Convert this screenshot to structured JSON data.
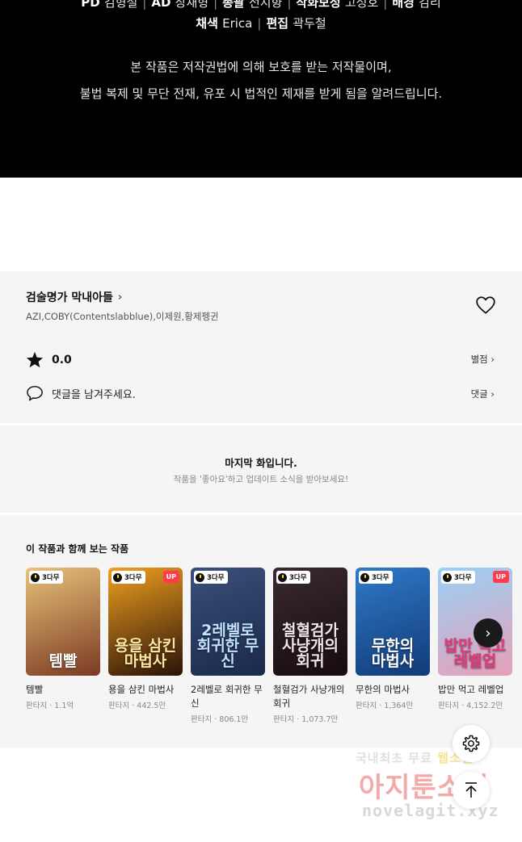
{
  "credits": {
    "line1": [
      {
        "role": "PD",
        "name": "김형철"
      },
      {
        "role": "AD",
        "name": "장재형"
      },
      {
        "role": "총괄",
        "name": "전지향"
      },
      {
        "role": "작화보정",
        "name": "고성호"
      },
      {
        "role": "배경",
        "name": "김리"
      }
    ],
    "line2": [
      {
        "role": "채색",
        "name": "Erica"
      },
      {
        "role": "편집",
        "name": "곽두철"
      }
    ],
    "separator": "|"
  },
  "notice": {
    "line1": "본 작품은 저작권법에 의해 보호를 받는 저작물이며,",
    "line2": "불법 복제 및 무단 전재, 유포 시 법적인 제재를 받게 됨을 알려드립니다."
  },
  "work": {
    "title": "검술명가 막내아들",
    "title_chevron": "›",
    "authors": "AZI,COBY(Contentslabblue),이제원,황제펭귄",
    "rating": "0.0",
    "rating_link": "별점 ›",
    "comment_prompt": "댓글을 남겨주세요.",
    "comment_link": "댓글 ›"
  },
  "last_episode": {
    "title": "마지막 화입니다.",
    "subtitle": "작품을 '좋아요'하고 업데이트 소식을 받아보세요!"
  },
  "recommendations": {
    "heading": "이 작품과 함께 보는 작품",
    "items": [
      {
        "badge": "3다무",
        "up": "",
        "cover": "템빨",
        "name": "템빨",
        "meta": "판타지 · 1.1억",
        "bg1": "#e9c27a",
        "bg2": "#7a3a22",
        "fg": "#ffffff"
      },
      {
        "badge": "3다무",
        "up": "UP",
        "cover": "용을 삼킨\n마법사",
        "name": "용을 삼킨 마법사",
        "meta": "판타지 · 442.5만",
        "bg1": "#f0a020",
        "bg2": "#2a1208",
        "fg": "#ffe7a0"
      },
      {
        "badge": "3다무",
        "up": "",
        "cover": "2레벨로\n회귀한 무신",
        "name": "2레벨로 회귀한 무신",
        "meta": "판타지 · 806.1만",
        "bg1": "#3a4f7a",
        "bg2": "#1a2a4a",
        "fg": "#bfe3ff"
      },
      {
        "badge": "3다무",
        "up": "",
        "cover": "철혈검가\n사냥개의 회귀",
        "name": "철혈검가 사냥개의 회귀",
        "meta": "판타지 · 1,073.7만",
        "bg1": "#3a2a32",
        "bg2": "#160a10",
        "fg": "#f0e6e6"
      },
      {
        "badge": "3다무",
        "up": "",
        "cover": "무한의\n마법사",
        "name": "무한의 마법사",
        "meta": "판타지 · 1,364만",
        "bg1": "#2f7ac8",
        "bg2": "#123a78",
        "fg": "#ffffff"
      },
      {
        "badge": "3다무",
        "up": "UP",
        "cover": "밥만 먹고\n레벨업",
        "name": "밥만 먹고 레벨업",
        "meta": "판타지 · 4,152.2만",
        "bg1": "#9ad0f5",
        "bg2": "#e6a0b8",
        "fg": "#e03a7a"
      }
    ],
    "next_icon": "›"
  },
  "watermark": {
    "line1_pre": "국내최초 무료 ",
    "line1_hl": "웹소설",
    "line2": "아지툰소설",
    "line3": "novelagit.xyz"
  }
}
